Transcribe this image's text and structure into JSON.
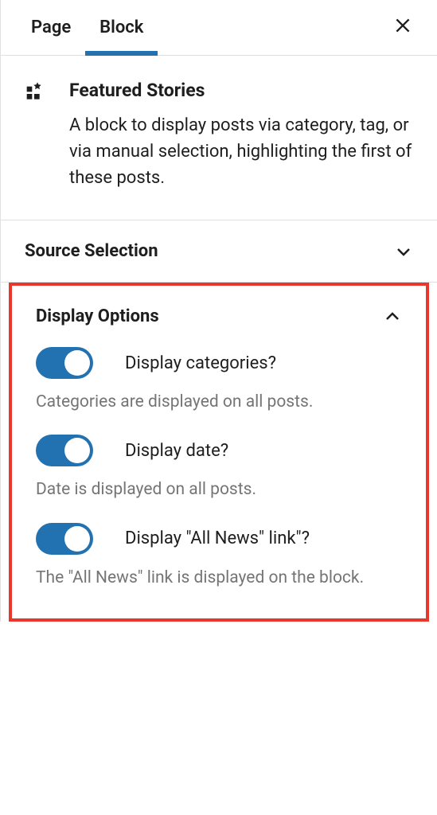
{
  "tabs": {
    "page": "Page",
    "block": "Block"
  },
  "block": {
    "title": "Featured Stories",
    "description": "A block to display posts via category, tag, or via manual selection, highlighting the first of these posts."
  },
  "sections": {
    "source_selection": {
      "title": "Source Selection"
    },
    "display_options": {
      "title": "Display Options",
      "options": [
        {
          "label": "Display categories?",
          "help": "Categories are displayed on all posts."
        },
        {
          "label": "Display date?",
          "help": "Date is displayed on all posts."
        },
        {
          "label": "Display \"All News\" link\"?",
          "help": "The \"All News\" link is displayed on the block."
        }
      ]
    }
  }
}
